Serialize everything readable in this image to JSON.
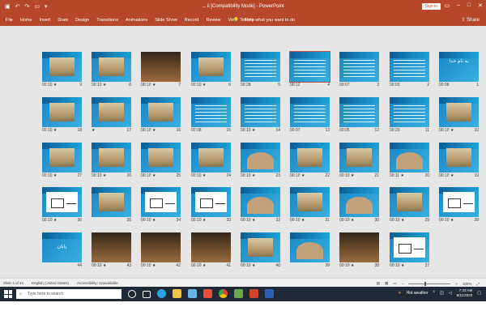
{
  "window": {
    "title": "... ii [Compatibility Mode] - PowerPoint",
    "sign_in": "Sign in",
    "share": "Share"
  },
  "ribbon": {
    "tabs": [
      "File",
      "Home",
      "Insert",
      "Draw",
      "Design",
      "Transitions",
      "Animations",
      "Slide Show",
      "Record",
      "Review",
      "View",
      "Help"
    ],
    "tell_me": "Tell me what you want to do"
  },
  "slides": [
    {
      "n": "9",
      "t": "00:10 ★",
      "kind": "photo"
    },
    {
      "n": "8",
      "t": "00:10 ★",
      "kind": "photo"
    },
    {
      "n": "7",
      "t": "00:10 ★",
      "kind": "dark"
    },
    {
      "n": "6",
      "t": "00:10 ★",
      "kind": "photo"
    },
    {
      "n": "5",
      "t": "00:28",
      "kind": "text"
    },
    {
      "n": "4",
      "t": "00:12",
      "kind": "text",
      "sel": true
    },
    {
      "n": "3",
      "t": "00:07",
      "kind": "text"
    },
    {
      "n": "2",
      "t": "00:03",
      "kind": "text"
    },
    {
      "n": "1",
      "t": "00:08",
      "kind": "title"
    },
    {
      "n": "18",
      "t": "00:10 ★",
      "kind": "photo"
    },
    {
      "n": "17",
      "t": "★",
      "kind": "photo"
    },
    {
      "n": "16",
      "t": "00:10 ★",
      "kind": "photo"
    },
    {
      "n": "15",
      "t": "00:08",
      "kind": "text"
    },
    {
      "n": "14",
      "t": "00:10 ★",
      "kind": "text"
    },
    {
      "n": "13",
      "t": "00:07",
      "kind": "text"
    },
    {
      "n": "12",
      "t": "00:05",
      "kind": "text"
    },
    {
      "n": "11",
      "t": "00:20",
      "kind": "text"
    },
    {
      "n": "10",
      "t": "00:10 ★",
      "kind": "photo"
    },
    {
      "n": "27",
      "t": "00:10 ★",
      "kind": "photo"
    },
    {
      "n": "26",
      "t": "00:10 ★",
      "kind": "photo"
    },
    {
      "n": "25",
      "t": "00:10 ★",
      "kind": "photo"
    },
    {
      "n": "24",
      "t": "00:10 ★",
      "kind": "photo"
    },
    {
      "n": "23",
      "t": "00:10 ★",
      "kind": "dome"
    },
    {
      "n": "22",
      "t": "00:10 ★",
      "kind": "photo"
    },
    {
      "n": "21",
      "t": "00:10 ★",
      "kind": "photo"
    },
    {
      "n": "20",
      "t": "00:11 ★",
      "kind": "dome"
    },
    {
      "n": "19",
      "t": "00:10 ★",
      "kind": "photo"
    },
    {
      "n": "36",
      "t": "00:10 ★",
      "kind": "diagram"
    },
    {
      "n": "35",
      "t": "",
      "kind": "photo"
    },
    {
      "n": "34",
      "t": "00:10 ★",
      "kind": "diagram"
    },
    {
      "n": "33",
      "t": "00:10 ★",
      "kind": "diagram"
    },
    {
      "n": "32",
      "t": "00:10 ★",
      "kind": "dome"
    },
    {
      "n": "31",
      "t": "00:10 ★",
      "kind": "photo"
    },
    {
      "n": "30",
      "t": "00:10 ★",
      "kind": "dome"
    },
    {
      "n": "29",
      "t": "00:10 ★",
      "kind": "photo"
    },
    {
      "n": "28",
      "t": "00:10 ★",
      "kind": "diagram"
    },
    {
      "n": "44",
      "t": "",
      "kind": "title2"
    },
    {
      "n": "43",
      "t": "00:10 ★",
      "kind": "dark"
    },
    {
      "n": "42",
      "t": "00:10 ★",
      "kind": "dark"
    },
    {
      "n": "41",
      "t": "00:10 ★",
      "kind": "dark"
    },
    {
      "n": "40",
      "t": "00:10 ★",
      "kind": "photo"
    },
    {
      "n": "39",
      "t": "",
      "kind": "dome"
    },
    {
      "n": "38",
      "t": "00:10 ★",
      "kind": "dark"
    },
    {
      "n": "37",
      "t": "00:10 ★",
      "kind": "diagram"
    }
  ],
  "title_slide_text": "به نام خدا",
  "end_slide_text": "پایان",
  "status": {
    "slide_info": "Slide 4 of 44",
    "language": "English (United States)",
    "accessibility": "Accessibility: Unavailable",
    "zoom": "100%"
  },
  "taskbar": {
    "search_placeholder": "Type here to search",
    "weather": "Hot weather",
    "time": "7:23 AM",
    "date": "8/11/2023"
  }
}
